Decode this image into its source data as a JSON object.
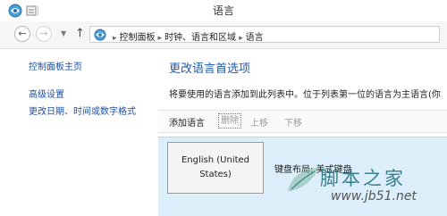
{
  "window": {
    "title": "语言"
  },
  "address": {
    "breadcrumb": [
      "控制面板",
      "时钟、语言和区域",
      "语言"
    ]
  },
  "sidebar": {
    "links": [
      {
        "label": "控制面板主页"
      },
      {
        "label": "高级设置"
      },
      {
        "label": "更改日期、时间或数字格式"
      }
    ]
  },
  "main": {
    "title": "更改语言首选项",
    "description": "将要使用的语言添加到此列表中。位于列表第一位的语言为主语言(你"
  },
  "toolbar": {
    "add_label": "添加语言",
    "remove_label": "删除",
    "up_label": "上移",
    "down_label": "下移"
  },
  "languages": [
    {
      "name": "English (United States)",
      "keyboard_label": "键盘布局: 美式键盘"
    }
  ],
  "watermark": {
    "text": "脚本之家",
    "url": "www.jb51.net"
  },
  "colors": {
    "link": "#1e4fa0",
    "title": "#1e5aa8",
    "list_bg": "#dbeef9"
  }
}
